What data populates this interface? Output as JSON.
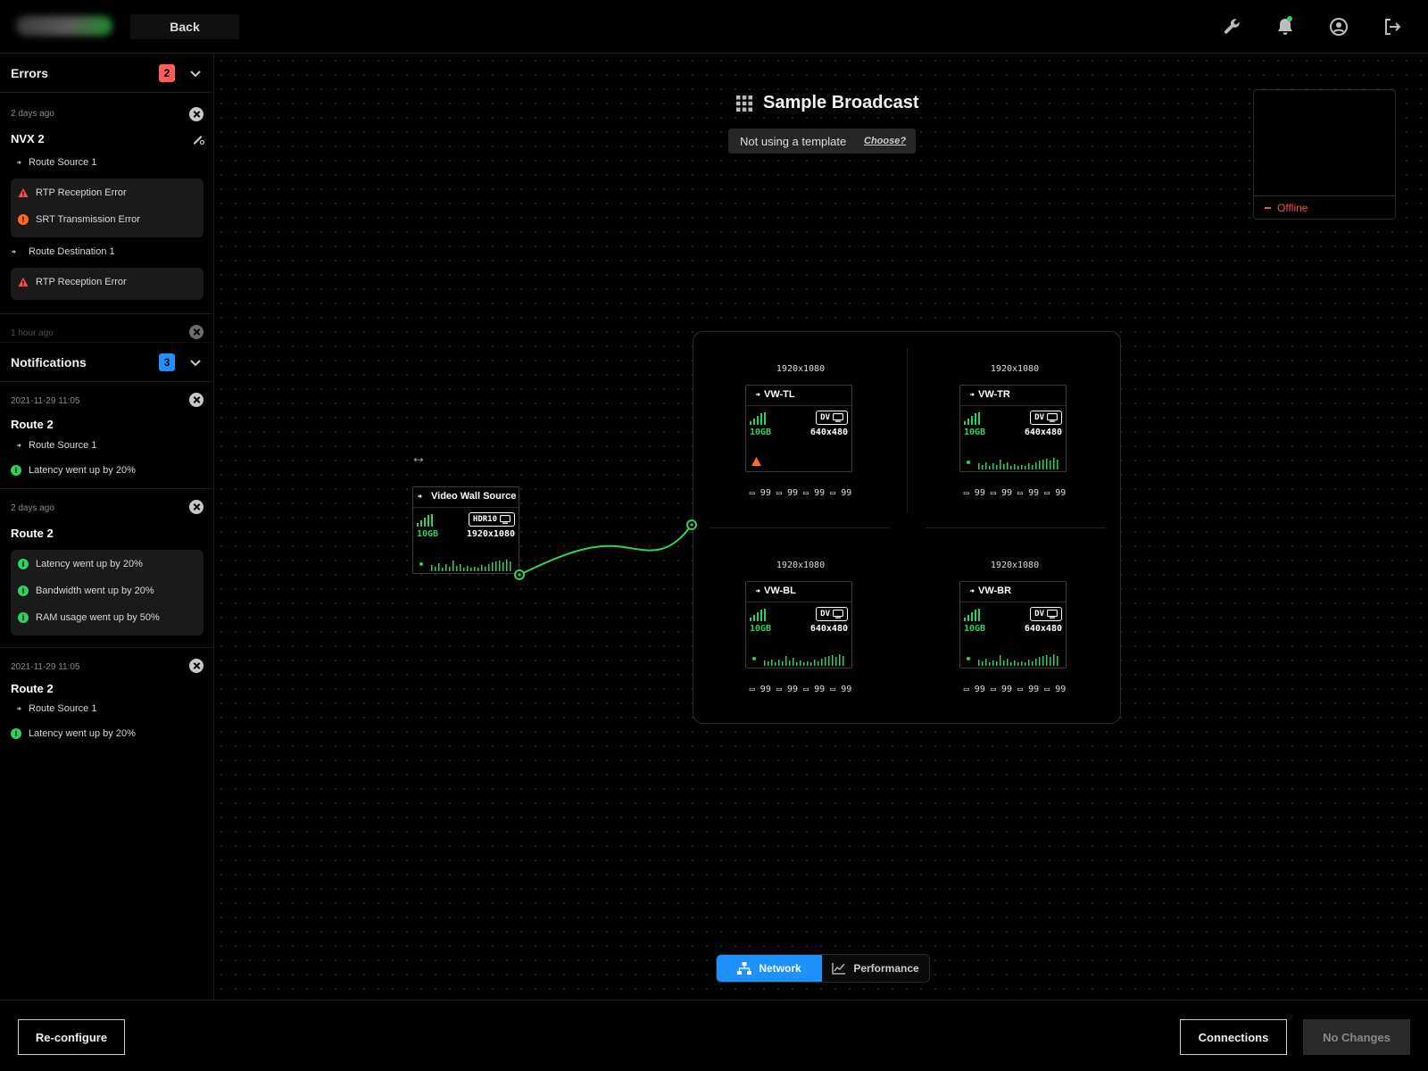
{
  "header": {
    "back_label": "Back"
  },
  "sidebar": {
    "errors": {
      "title": "Errors",
      "count": "2",
      "cards": [
        {
          "timestamp": "2 days ago",
          "name": "NVX 2",
          "source": "Route Source 1",
          "source_errors": [
            "RTP Reception Error",
            "SRT Transmission Error"
          ],
          "destination": "Route Destination 1",
          "destination_errors": [
            "RTP Reception Error"
          ]
        },
        {
          "timestamp": "1 hour ago"
        }
      ]
    },
    "notifications": {
      "title": "Notifications",
      "count": "3",
      "cards": [
        {
          "timestamp": "2021-11-29 11:05",
          "name": "Route 2",
          "source": "Route Source 1",
          "items": [
            "Latency went up by 20%"
          ]
        },
        {
          "timestamp": "2 days ago",
          "name": "Route 2",
          "items": [
            "Latency went up by 20%",
            "Bandwidth went up by 20%",
            "RAM usage went up by 50%"
          ]
        },
        {
          "timestamp": "2021-11-29 11:05",
          "name": "Route 2",
          "source": "Route Source 1",
          "items": [
            "Latency went up by 20%"
          ]
        }
      ]
    }
  },
  "canvas": {
    "title": "Sample Broadcast",
    "template_text": "Not using a template",
    "template_link": "Choose?",
    "preview_status": "Offline",
    "source_node": {
      "name": "Video Wall Source",
      "bandwidth": "10GB",
      "tag": "HDR10",
      "resolution": "1920x1080"
    },
    "wall": {
      "quadrants": [
        {
          "id": "tl",
          "output_res": "1920x1080",
          "name": "VW-TL",
          "bandwidth": "10GB",
          "tag": "DV",
          "resolution": "640x480",
          "warning": true,
          "stats": [
            "99",
            "99",
            "99",
            "99"
          ]
        },
        {
          "id": "tr",
          "output_res": "1920x1080",
          "name": "VW-TR",
          "bandwidth": "10GB",
          "tag": "DV",
          "resolution": "640x480",
          "warning": false,
          "stats": [
            "99",
            "99",
            "99",
            "99"
          ]
        },
        {
          "id": "bl",
          "output_res": "1920x1080",
          "name": "VW-BL",
          "bandwidth": "10GB",
          "tag": "DV",
          "resolution": "640x480",
          "warning": false,
          "stats": [
            "99",
            "99",
            "99",
            "99"
          ]
        },
        {
          "id": "br",
          "output_res": "1920x1080",
          "name": "VW-BR",
          "bandwidth": "10GB",
          "tag": "DV",
          "resolution": "640x480",
          "warning": false,
          "stats": [
            "99",
            "99",
            "99",
            "99"
          ]
        }
      ]
    },
    "view_toggle": {
      "network_label": "Network",
      "performance_label": "Performance",
      "active": "network"
    }
  },
  "footer": {
    "reconfigure_label": "Re-configure",
    "connections_label": "Connections",
    "no_changes_label": "No Changes"
  },
  "colors": {
    "accent_green": "#2ed160",
    "accent_blue": "#1e90ff",
    "error_red": "#ff4a4a",
    "error_orange": "#ff6a2a",
    "error_badge": "#ff5c5c",
    "notif_badge": "#1e90ff"
  },
  "icons": {
    "header": [
      "wrench-icon",
      "bell-icon",
      "user-circle-icon",
      "logout-icon"
    ],
    "source": "source-moon-icon",
    "destination": "destination-moon-icon",
    "error": "warning-triangle-icon",
    "transmission_error": "alert-circle-icon",
    "info": "info-circle-icon"
  }
}
